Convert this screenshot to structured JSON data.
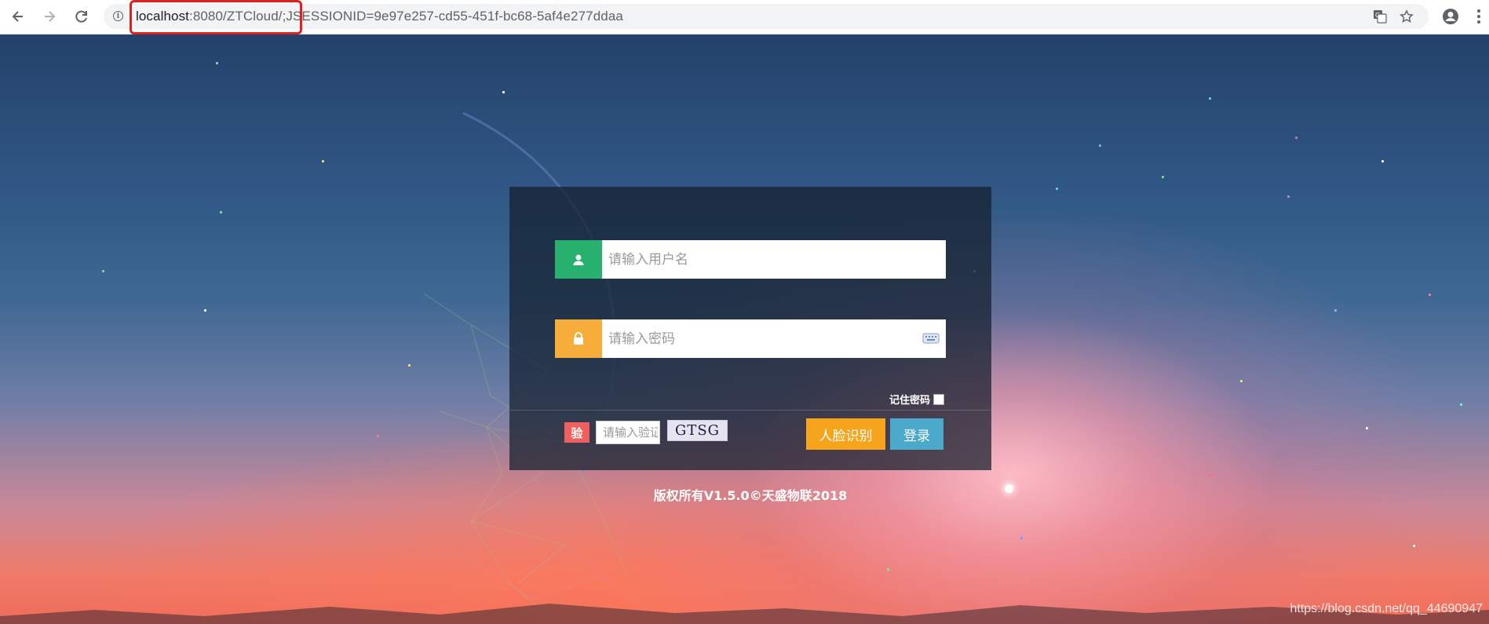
{
  "browser": {
    "url_host": "localhost",
    "url_rest": ":8080/ZTCloud/;JSESSIONID=9e97e257-cd55-451f-bc68-5af4e277ddaa",
    "icons": [
      "back-arrow-icon",
      "forward-arrow-icon",
      "reload-icon",
      "info-icon",
      "translate-icon",
      "star-icon",
      "account-icon",
      "menu-dots-icon"
    ]
  },
  "login": {
    "username_placeholder": "请输入用户名",
    "password_placeholder": "请输入密码",
    "remember_label": "记住密码",
    "remember_checked": false,
    "verify_badge": "验",
    "verify_placeholder": "请输入验证码",
    "captcha_text": "GTSG",
    "face_button": "人脸识别",
    "login_button": "登录",
    "colors": {
      "user_addon": "#27b06e",
      "lock_addon": "#f6ad3a",
      "face_button": "#f7a41d",
      "login_button": "#4ba9cc",
      "verify_badge": "#f05f5f"
    }
  },
  "footer": {
    "copyright": "版权所有V1.5.0©天盛物联2018",
    "watermark": "https://blog.csdn.net/qq_44690947"
  }
}
